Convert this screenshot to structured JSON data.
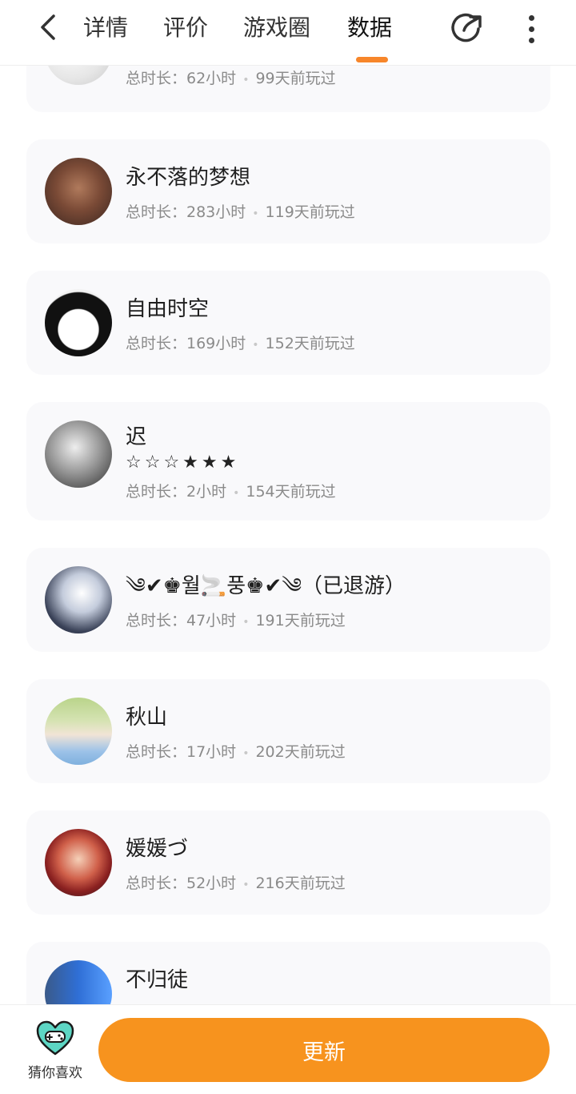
{
  "header": {
    "tabs": [
      {
        "label": "详情"
      },
      {
        "label": "评价"
      },
      {
        "label": "游戏圈"
      },
      {
        "label": "数据"
      }
    ],
    "active_tab": "数据",
    "accent_color": "#f7862a"
  },
  "players": [
    {
      "name": "",
      "duration": "总时长：62小时",
      "last_played": "99天前玩过",
      "avatar_colors": [
        "#f2f2f2",
        "#cccccc"
      ]
    },
    {
      "name": "永不落的梦想",
      "duration": "总时长：283小时",
      "last_played": "119天前玩过",
      "avatar_colors": [
        "#5a3b2e",
        "#b07a5c"
      ]
    },
    {
      "name": "自由时空",
      "duration": "总时长：169小时",
      "last_played": "152天前玩过",
      "avatar_colors": [
        "#ffffff",
        "#111111"
      ]
    },
    {
      "name": "迟",
      "stars": "☆☆☆★★★",
      "duration": "总时长：2小时",
      "last_played": "154天前玩过",
      "avatar_colors": [
        "#d9d9d9",
        "#3a3a3a"
      ]
    },
    {
      "name": "༄✔♚월🚬풍♚✔༄（已退游）",
      "duration": "总时长：47小时",
      "last_played": "191天前玩过",
      "avatar_colors": [
        "#e8ecf4",
        "#2a2f3f"
      ]
    },
    {
      "name": "秋山",
      "duration": "总时长：17小时",
      "last_played": "202天前玩过",
      "avatar_colors": [
        "#c8d99a",
        "#9cc2e8"
      ]
    },
    {
      "name": "媛媛づ",
      "duration": "总时长：52小时",
      "last_played": "216天前玩过",
      "avatar_colors": [
        "#2a1f2a",
        "#c23a3a"
      ]
    },
    {
      "name": "不归徒",
      "duration": "",
      "last_played": "",
      "avatar_colors": [
        "#2f6fd6",
        "#5aa0ff"
      ]
    }
  ],
  "bottom": {
    "guess_label": "猜你喜欢",
    "guess_icon": "heart-gamepad-icon",
    "update_label": "更新",
    "button_color": "#f7931e"
  }
}
